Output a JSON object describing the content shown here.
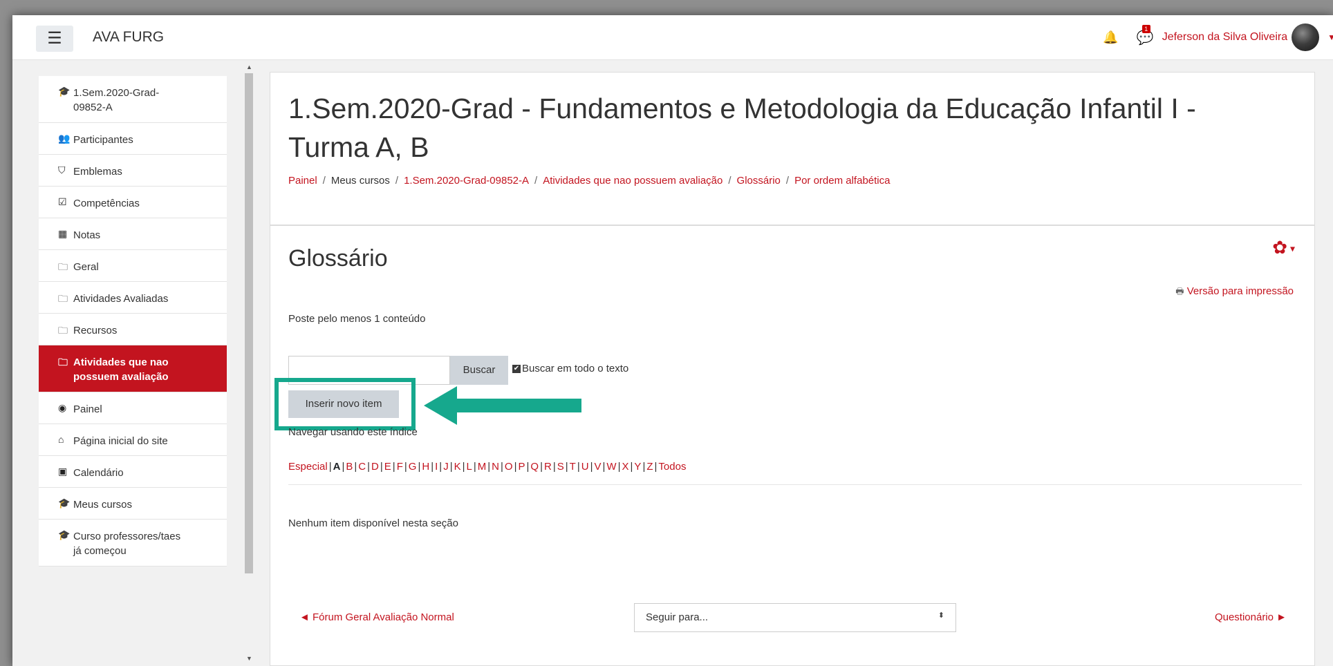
{
  "navbar": {
    "menu_icon": "☰",
    "site_name": "AVA FURG",
    "bell_icon": "🔔",
    "message_icon": "💬",
    "message_count": "1",
    "user_name": "Jeferson da Silva Oliveira",
    "user_menu_caret": "▼"
  },
  "drawer": {
    "items": [
      {
        "icon": "graduation-cap-icon",
        "glyph": "🎓",
        "label": "1.Sem.2020-Grad-\n09852-A"
      },
      {
        "icon": "users-icon",
        "glyph": "👥",
        "label": "Participantes"
      },
      {
        "icon": "shield-icon",
        "glyph": "⛉",
        "label": "Emblemas"
      },
      {
        "icon": "check-square-icon",
        "glyph": "☑",
        "label": "Competências"
      },
      {
        "icon": "table-icon",
        "glyph": "▦",
        "label": "Notas"
      },
      {
        "icon": "folder-icon",
        "glyph": "🗀",
        "label": "Geral"
      },
      {
        "icon": "folder-icon",
        "glyph": "🗀",
        "label": "Atividades Avaliadas"
      },
      {
        "icon": "folder-icon",
        "glyph": "🗀",
        "label": "Recursos"
      },
      {
        "icon": "folder-icon",
        "glyph": "🗀",
        "label": "Atividades que nao\npossuem avaliação",
        "active": true
      },
      {
        "icon": "dashboard-icon",
        "glyph": "◉",
        "label": "Painel"
      },
      {
        "icon": "home-icon",
        "glyph": "⌂",
        "label": "Página inicial do site"
      },
      {
        "icon": "calendar-icon",
        "glyph": "▣",
        "label": "Calendário"
      },
      {
        "icon": "graduation-cap-icon",
        "glyph": "🎓",
        "label": "Meus cursos"
      },
      {
        "icon": "graduation-cap-icon",
        "glyph": "🎓",
        "label": "Curso professores/taes\njá começou"
      }
    ]
  },
  "header": {
    "title": "1.Sem.2020-Grad - Fundamentos e Metodologia da Educação Infantil I - Turma A, B",
    "breadcrumb": [
      "Painel",
      "Meus cursos",
      "1.Sem.2020-Grad-09852-A",
      "Atividades que nao possuem avaliação",
      "Glossário",
      "Por ordem alfabética"
    ]
  },
  "glossary": {
    "title": "Glossário",
    "settings_icon": "gear-icon",
    "print_icon": "🖶",
    "print_label": "Versão para impressão",
    "intro": "Poste pelo menos 1 conteúdo",
    "search_value": "",
    "search_button": "Buscar",
    "search_fulltext_label": "Buscar em todo o texto",
    "search_fulltext_checked": true,
    "add_button": "Inserir novo item",
    "browse_label": "Navegar usando este índice",
    "special_label": "Especial",
    "letters": [
      "A",
      "B",
      "C",
      "D",
      "E",
      "F",
      "G",
      "H",
      "I",
      "J",
      "K",
      "L",
      "M",
      "N",
      "O",
      "P",
      "Q",
      "R",
      "S",
      "T",
      "U",
      "V",
      "W",
      "X",
      "Y",
      "Z"
    ],
    "current_letter": "A",
    "all_label": "Todos",
    "no_items": "Nenhum item disponível nesta seção"
  },
  "footer_nav": {
    "prev_label": "◄ Fórum Geral Avaliação Normal",
    "jump_placeholder": "Seguir para...",
    "jump_caret": "⬍",
    "next_label": "Questionário ►"
  },
  "annotation": {
    "highlight_color": "#16a88d"
  },
  "colors": {
    "accent": "#c3141f",
    "button": "#ced4da"
  }
}
